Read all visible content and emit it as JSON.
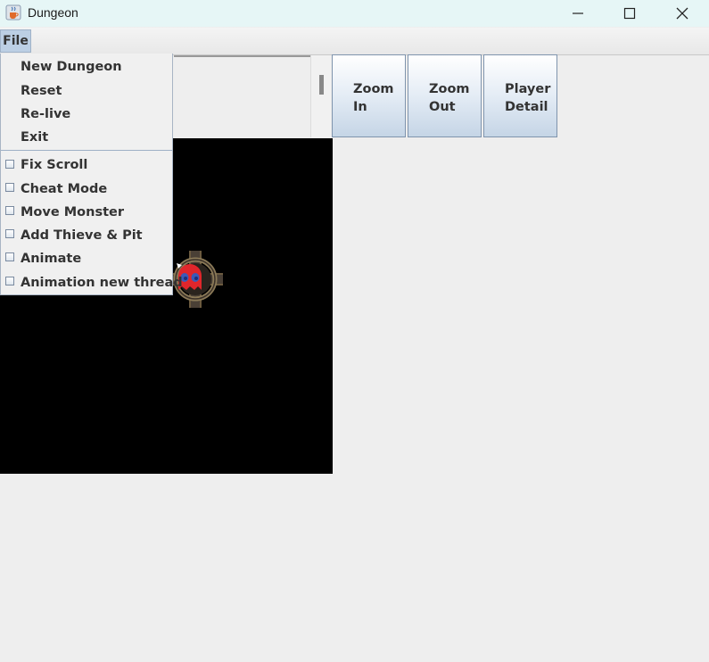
{
  "window": {
    "title": "Dungeon",
    "app_icon": "java-cup-icon",
    "controls": [
      "minimize-icon",
      "maximize-icon",
      "close-icon"
    ]
  },
  "menubar": {
    "file_label": "File"
  },
  "file_menu": {
    "items": [
      {
        "label": "New Dungeon"
      },
      {
        "label": "Reset"
      },
      {
        "label": "Re-live"
      },
      {
        "label": "Exit"
      }
    ],
    "check_items": [
      {
        "label": "Fix Scroll",
        "checked": false
      },
      {
        "label": "Cheat Mode",
        "checked": false
      },
      {
        "label": "Move Monster",
        "checked": false
      },
      {
        "label": "Add Thieve & Pit",
        "checked": false
      },
      {
        "label": "Animate",
        "checked": false
      },
      {
        "label": "Animation new thread",
        "checked": false
      }
    ]
  },
  "toolbar": {
    "buttons": [
      {
        "line1": "Zoom",
        "line2": "In"
      },
      {
        "line1": "Zoom",
        "line2": "Out"
      },
      {
        "line1": "Player",
        "line2": "Detail"
      }
    ]
  },
  "dungeon": {
    "background": "#000000",
    "sprite": "ghost-monster-icon",
    "sprite_color": "#e0262b"
  }
}
